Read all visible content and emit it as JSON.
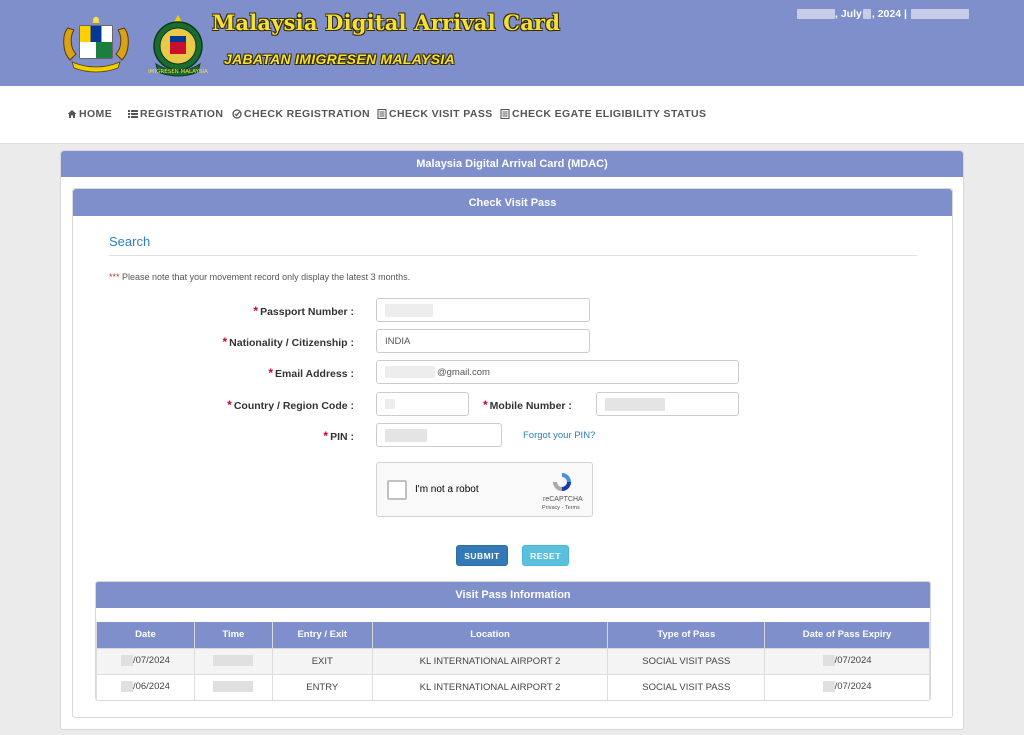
{
  "header": {
    "title": "Malaysia Digital Arrival Card",
    "subtitle": "JABATAN IMIGRESEN MALAYSIA",
    "crest_label": "IMIGRESEN MALAYSIA",
    "date_text": ", July",
    "year_text": ", 2024 |"
  },
  "nav": {
    "items": [
      {
        "label": "HOME",
        "icon": "home-icon"
      },
      {
        "label": "REGISTRATION",
        "icon": "list-icon"
      },
      {
        "label": "CHECK REGISTRATION",
        "icon": "check-circle-icon"
      },
      {
        "label": "CHECK VISIT PASS",
        "icon": "document-icon"
      },
      {
        "label": "CHECK EGATE ELIGIBILITY STATUS",
        "icon": "document-icon"
      }
    ]
  },
  "outer_panel": {
    "title": "Malaysia Digital Arrival Card (MDAC)"
  },
  "inner_panel": {
    "title": "Check Visit Pass"
  },
  "search": {
    "title": "Search",
    "note_stars": "***",
    "note": " Please note that your movement record only display the latest 3 months."
  },
  "form": {
    "required_mark": "*",
    "passport_label": "Passport Number :",
    "nationality_label": "Nationality / Citizenship :",
    "nationality_value": "INDIA",
    "email_label": "Email Address :",
    "email_value": "@gmail.com",
    "country_label": "Country / Region Code :",
    "mobile_label": "Mobile Number :",
    "pin_label": "PIN :",
    "forgot_pin": "Forgot your PIN?"
  },
  "captcha": {
    "label": "I'm not a robot",
    "brand": "reCAPTCHA",
    "terms": "Privacy - Terms"
  },
  "buttons": {
    "submit": "SUBMIT",
    "reset": "RESET"
  },
  "visit_pass": {
    "title": "Visit Pass Information",
    "columns": [
      "Date",
      "Time",
      "Entry / Exit",
      "Location",
      "Type of Pass",
      "Date of Pass Expiry"
    ],
    "rows": [
      {
        "date": "/07/2024",
        "entry_exit": "EXIT",
        "location": "KL INTERNATIONAL AIRPORT 2",
        "type": "SOCIAL VISIT PASS",
        "expiry": "/07/2024"
      },
      {
        "date": "/06/2024",
        "entry_exit": "ENTRY",
        "location": "KL INTERNATIONAL AIRPORT 2",
        "type": "SOCIAL VISIT PASS",
        "expiry": "/07/2024"
      }
    ]
  },
  "colors": {
    "header_bg": "#7f8fcc",
    "title_yellow": "#f3e03a",
    "link_blue": "#2d7fc0",
    "submit_blue": "#3379b7",
    "reset_cyan": "#5bc0de",
    "required_red": "#d0021b"
  }
}
